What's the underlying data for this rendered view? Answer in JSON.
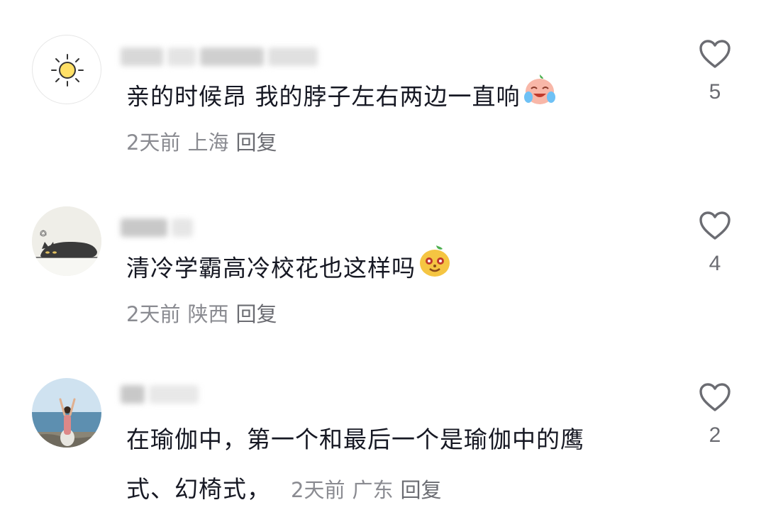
{
  "comments": [
    {
      "text": "亲的时候昂 我的脖子左右两边一直响",
      "emoji": "crying-laughing-emoji",
      "time": "2天前",
      "location": "上海",
      "reply": "回复",
      "likes": "5"
    },
    {
      "text": "清冷学霸高冷校花也这样吗",
      "emoji": "cheeky-mascot-emoji",
      "time": "2天前",
      "location": "陕西",
      "reply": "回复",
      "likes": "4"
    },
    {
      "text_line1": "在瑜伽中，第一个和最后一个是瑜伽中的鹰",
      "text_line2": "式、幻椅式，",
      "time": "2天前",
      "location": "广东",
      "reply": "回复",
      "likes": "2"
    }
  ],
  "icons": {
    "like": "heart-outline-icon",
    "avatar1": "sun-icon"
  },
  "colors": {
    "text": "#161823",
    "meta": "#8a8b91",
    "icon": "#6b6c72"
  }
}
